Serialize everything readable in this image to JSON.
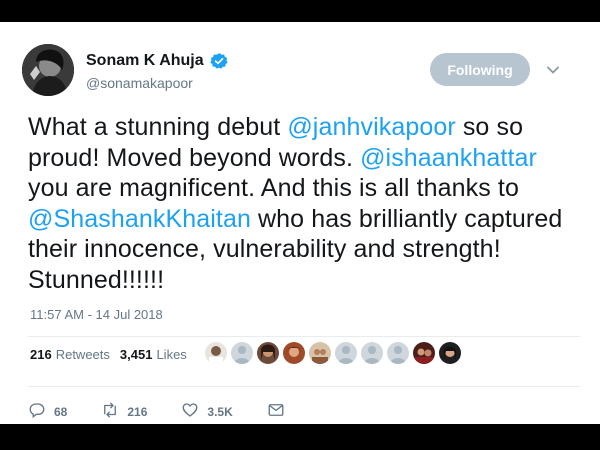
{
  "tweet": {
    "author_name": "Sonam K Ahuja",
    "handle": "@sonamakapoor",
    "follow_label": "Following",
    "text_parts": [
      {
        "t": "What a stunning debut ",
        "mention": false
      },
      {
        "t": "@janhvikapoor",
        "mention": true
      },
      {
        "t": " so so proud! Moved beyond words. ",
        "mention": false
      },
      {
        "t": "@ishaankhattar",
        "mention": true
      },
      {
        "t": " you are magnificent. And this is all thanks to ",
        "mention": false
      },
      {
        "t": "@ShashankKhaitan",
        "mention": true
      },
      {
        "t": " who has brilliantly captured their innocence, vulnerability and strength! Stunned!!!!!!",
        "mention": false
      }
    ],
    "timestamp": "11:57 AM - 14 Jul 2018",
    "stats": {
      "retweets_count": "216",
      "retweets_label": "Retweets",
      "likes_count": "3,451",
      "likes_label": "Likes"
    },
    "actions": {
      "replies": "68",
      "retweets": "216",
      "likes": "3.5K"
    },
    "colors": {
      "accent": "#1da1f2",
      "verified": "#1da1f2",
      "follow_button": "#b7c5d1",
      "text": "#14171a",
      "muted": "#657786"
    }
  }
}
